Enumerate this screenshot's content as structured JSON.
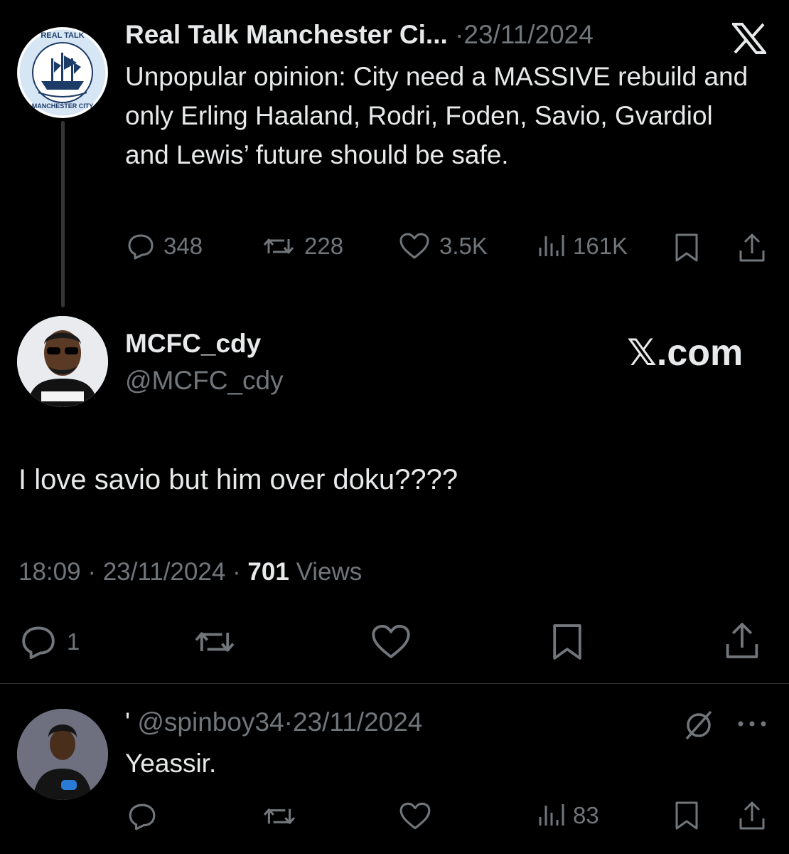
{
  "quoted_tweet": {
    "author_name": "Real Talk Manchester Ci...",
    "separator": "·",
    "date": "23/11/2024",
    "text": "Unpopular opinion: City need a MASSIVE rebuild and only Erling Haaland, Rodri, Foden, Savio, Gvardiol and Lewis’ future should be safe.",
    "avatar_text_top": "REAL TALK",
    "avatar_text_bottom": "MANCHESTER CITY",
    "stats": {
      "replies": "348",
      "reposts": "228",
      "likes": "3.5K",
      "views": "161K"
    },
    "platform_icon": "x-logo-icon"
  },
  "main_tweet": {
    "display_name": "MCFC_cdy",
    "handle": "@MCFC_cdy",
    "brand": "𝕏.com",
    "text": "I love savio but him over doku????",
    "time": "18:09",
    "date": "23/11/2024",
    "sep1": "·",
    "sep2": "·",
    "views_count": "701",
    "views_label": "Views",
    "stats": {
      "replies": "1"
    }
  },
  "reply": {
    "name_prefix": "'",
    "handle": "@spinboy34",
    "separator": "·",
    "date": "23/11/2024",
    "text": "Yeassir.",
    "stats": {
      "views": "83"
    }
  },
  "colors": {
    "background": "#000000",
    "text": "#e7e9ea",
    "muted": "#71767b",
    "divider": "#2f3336"
  }
}
